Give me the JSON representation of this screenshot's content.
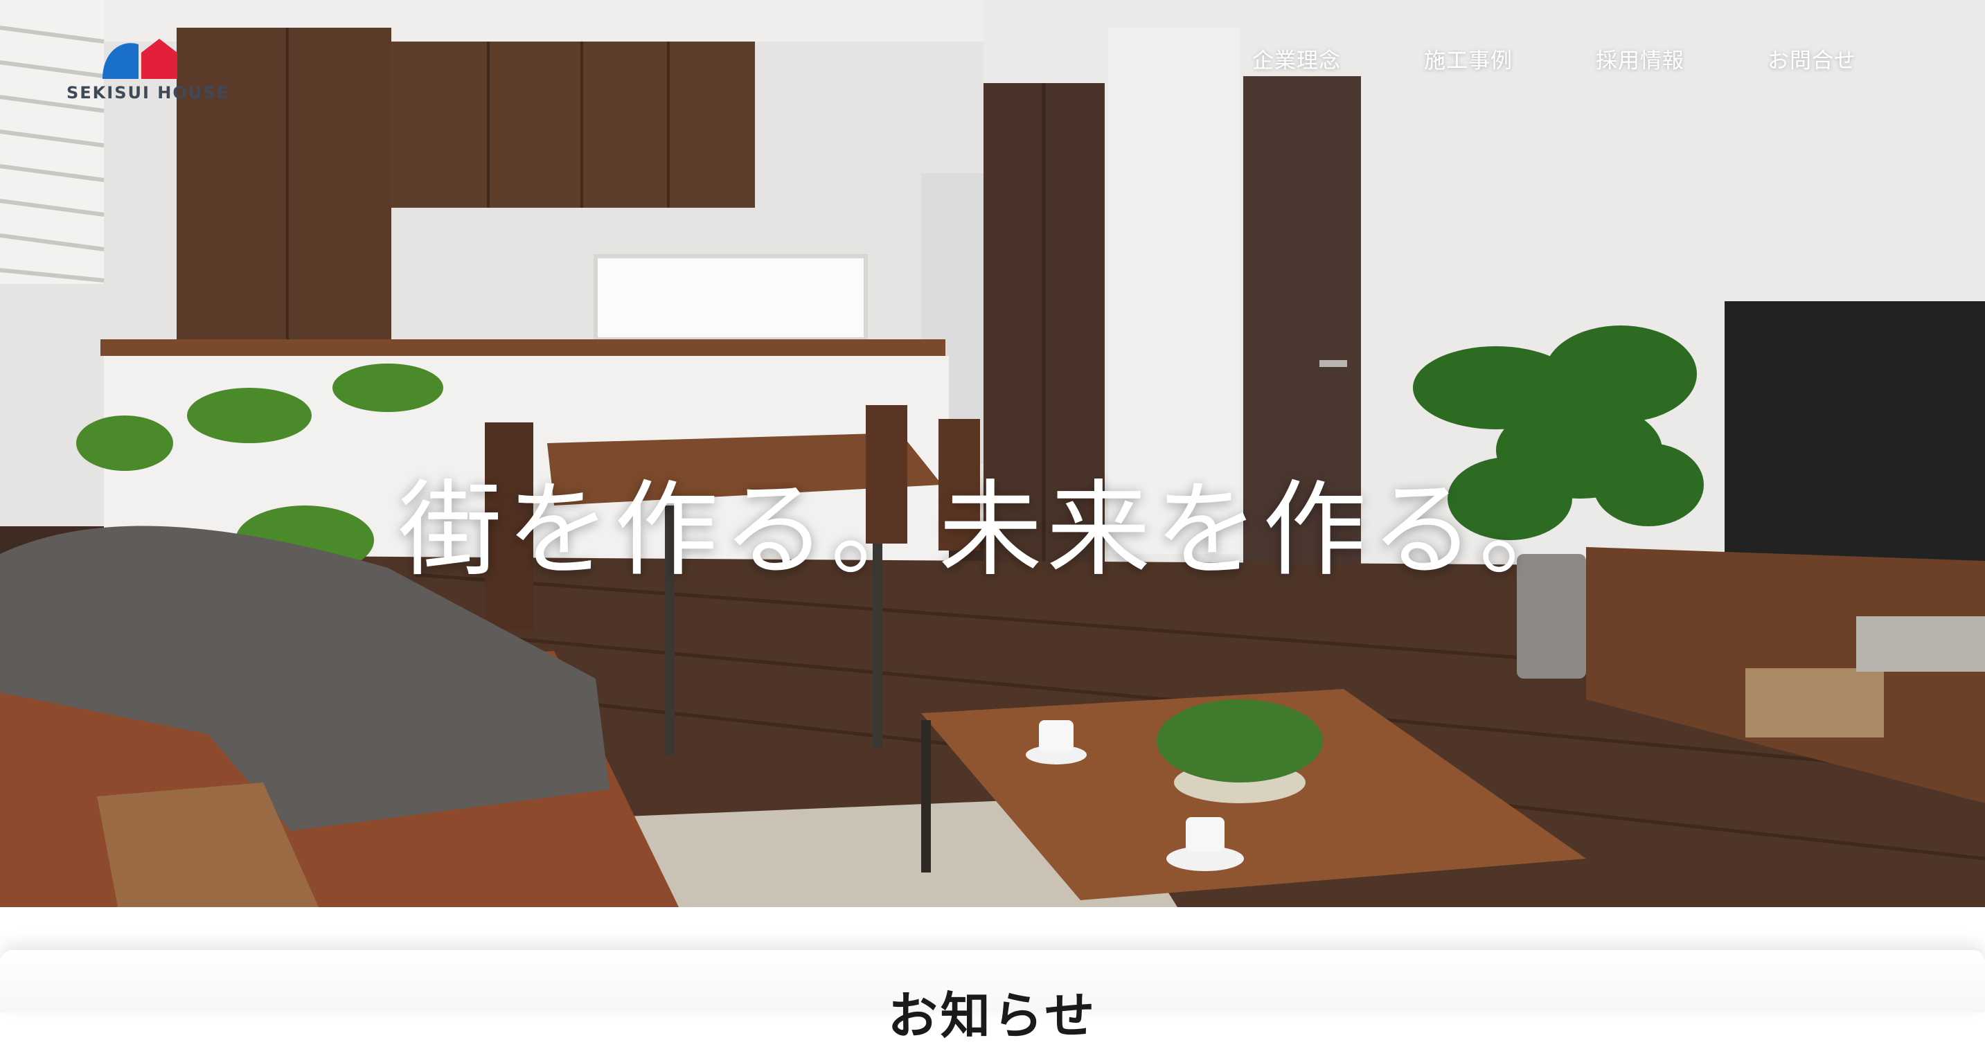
{
  "brand": {
    "name": "SEKISUI HOUSE",
    "colors": {
      "blue": "#1a6fc9",
      "red": "#e3203a"
    }
  },
  "nav": {
    "items": [
      {
        "label": "企業理念"
      },
      {
        "label": "施工事例"
      },
      {
        "label": "採用情報"
      },
      {
        "label": "お問合せ"
      }
    ]
  },
  "hero": {
    "tagline": "街を作る。未来を作る。",
    "image": "living-dining-interior-photo"
  },
  "news": {
    "heading": "お知らせ"
  }
}
